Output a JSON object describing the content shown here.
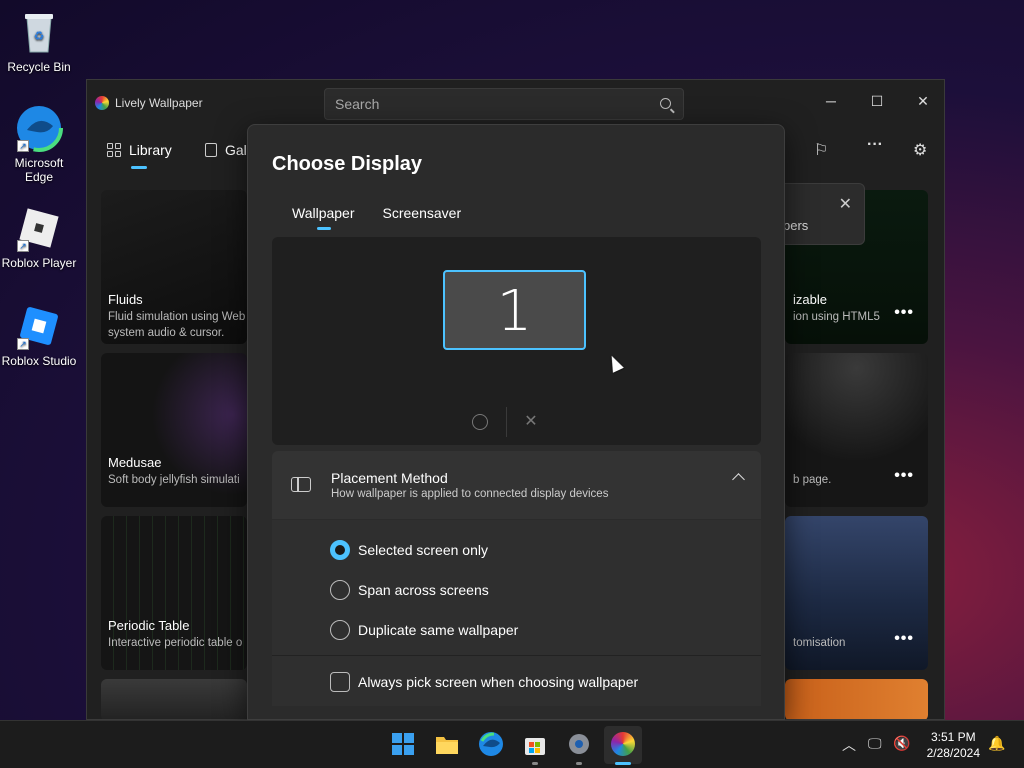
{
  "desktop": {
    "icons": [
      {
        "label": "Recycle Bin"
      },
      {
        "label": "Microsoft Edge"
      },
      {
        "label": "Roblox Player"
      },
      {
        "label": "Roblox Studio"
      }
    ]
  },
  "window": {
    "title": "Lively Wallpaper",
    "search_placeholder": "Search",
    "controls": {
      "minimize": "─",
      "maximize": "☐",
      "close": "✕"
    },
    "nav": {
      "library": "Library",
      "gallery": "Gal"
    },
    "toast_text": "pers",
    "tiles_left": [
      {
        "title": "Fluids",
        "desc_1": "Fluid simulation using Web",
        "desc_2": "system audio & cursor."
      },
      {
        "title": "Medusae",
        "desc_1": "Soft body jellyfish simulati"
      },
      {
        "title": "Periodic Table",
        "desc_1": "Interactive periodic table o"
      }
    ],
    "tiles_right": [
      {
        "title": "izable",
        "desc": "ion using HTML5"
      },
      {
        "title": "",
        "desc": "b page."
      },
      {
        "title": "",
        "desc": "tomisation"
      }
    ],
    "more_label": "•••"
  },
  "dialog": {
    "title": "Choose Display",
    "tabs": [
      "Wallpaper",
      "Screensaver"
    ],
    "monitor_number": "1",
    "placement": {
      "title": "Placement Method",
      "subtitle": "How wallpaper is applied to connected display devices",
      "options": [
        "Selected screen only",
        "Span across screens",
        "Duplicate same wallpaper"
      ],
      "selected_index": 0
    },
    "always_pick": "Always pick screen when choosing wallpaper"
  },
  "taskbar": {
    "time": "3:51 PM",
    "date": "2/28/2024"
  },
  "colors": {
    "accent": "#4cc2ff",
    "window_bg": "#202020",
    "dialog_bg": "#2b2b2b"
  }
}
